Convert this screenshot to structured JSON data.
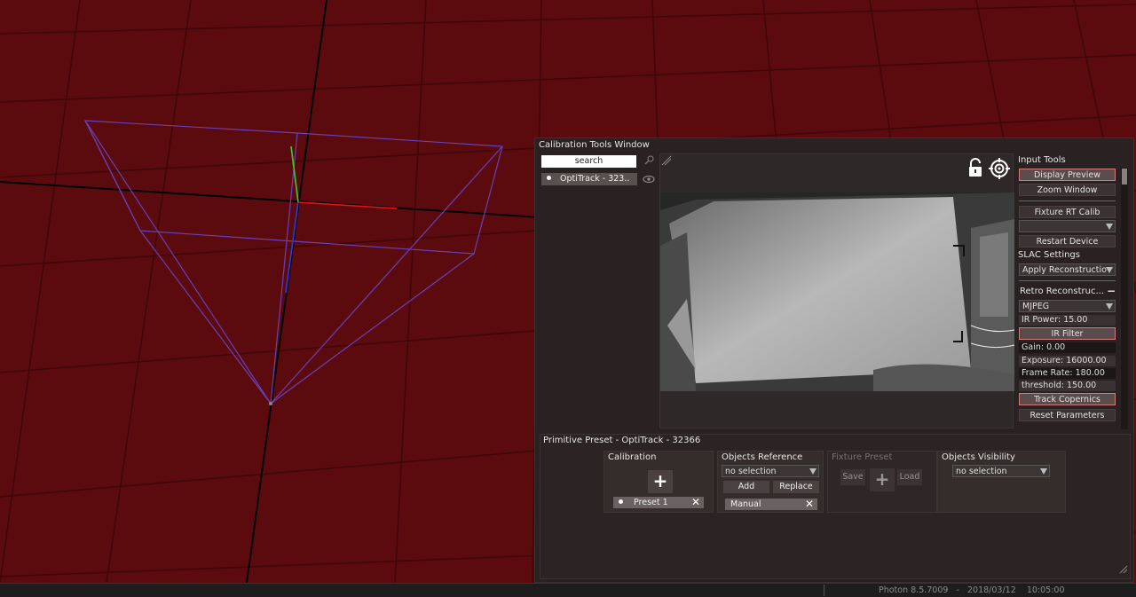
{
  "window": {
    "title": "Calibration Tools Window"
  },
  "device_list": {
    "search_placeholder": "search",
    "items": [
      {
        "label": "OptiTrack - 323.."
      }
    ]
  },
  "input_tools": {
    "heading": "Input Tools",
    "display_preview": "Display Preview",
    "zoom_window": "Zoom Window",
    "fixture_rt_calib": "Fixture RT Calib",
    "fixture_dropdown": "",
    "restart_device": "Restart Device",
    "slac_heading": "SLAC Settings",
    "apply_reconstruction": "Apply Reconstructio",
    "retro_heading": "Retro Reconstruc...",
    "retro_collapse": "−",
    "codec": "MJPEG",
    "ir_power": "IR Power: 15.00",
    "ir_filter": "IR Filter",
    "gain": "Gain: 0.00",
    "exposure": "Exposure: 16000.00",
    "frame_rate": "Frame Rate: 180.00",
    "threshold": "threshold: 150.00",
    "track_copernics": "Track Copernics",
    "reset_parameters": "Reset Parameters"
  },
  "preset": {
    "title": "Primitive Preset - OptiTrack - 32366",
    "calibration": {
      "label": "Calibration",
      "items": [
        "Preset 1"
      ]
    },
    "objects_reference": {
      "label": "Objects Reference",
      "selection": "no selection",
      "add": "Add",
      "replace": "Replace",
      "items": [
        "Manual"
      ]
    },
    "fixture_preset": {
      "label": "Fixture Preset",
      "save": "Save",
      "load": "Load"
    },
    "objects_visibility": {
      "label": "Objects Visibility",
      "selection": "no selection"
    }
  },
  "status_bar": {
    "text": "Photon 8.5.7009   -   2018/03/12    10:05:00"
  },
  "colors": {
    "viewport_bg": "#5b0b0e",
    "grid_line": "#3a0608",
    "frustum": "#6a3fb8",
    "axis_x": "#e01515",
    "axis_y": "#39d12a",
    "axis_z": "#2a3fe0",
    "highlight_border": "#d37a7a"
  }
}
